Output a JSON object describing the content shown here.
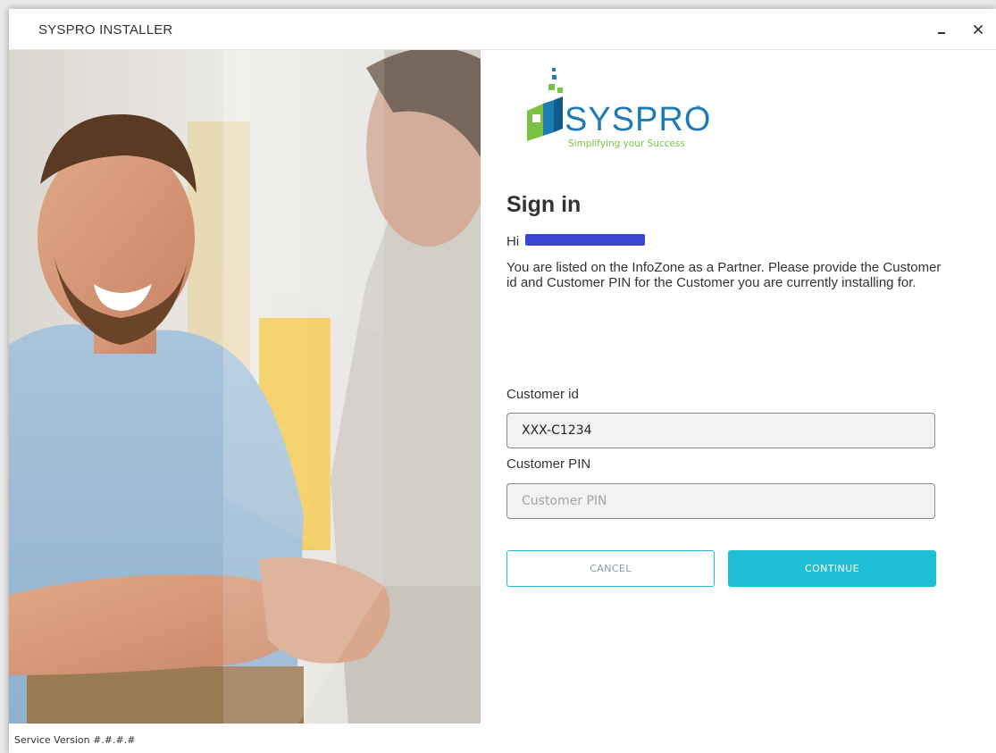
{
  "window": {
    "title": "SYSPRO INSTALLER",
    "minimize_icon": "minimize-icon",
    "close_icon": "close-icon"
  },
  "logo": {
    "wordmark": "SYSPRO",
    "tm": "™",
    "tagline": "Simplifying your Success"
  },
  "signin": {
    "title": "Sign in",
    "greeting": "Hi",
    "description": "You are listed on the InfoZone as a Partner. Please provide the Customer id and Customer PIN for the Customer you are currently installing for."
  },
  "form": {
    "customer_id_label": "Customer id",
    "customer_id_value": "XXX-C1234",
    "customer_pin_label": "Customer PIN",
    "customer_pin_placeholder": "Customer PIN",
    "customer_pin_value": ""
  },
  "buttons": {
    "cancel": "CANCEL",
    "continue": "CONTINUE"
  },
  "footer": {
    "service_version": "Service Version #.#.#.#"
  },
  "colors": {
    "accent": "#1ebfd6",
    "logo_blue": "#1f7bb5",
    "logo_green": "#7cc242",
    "redaction": "#3a45d6"
  }
}
